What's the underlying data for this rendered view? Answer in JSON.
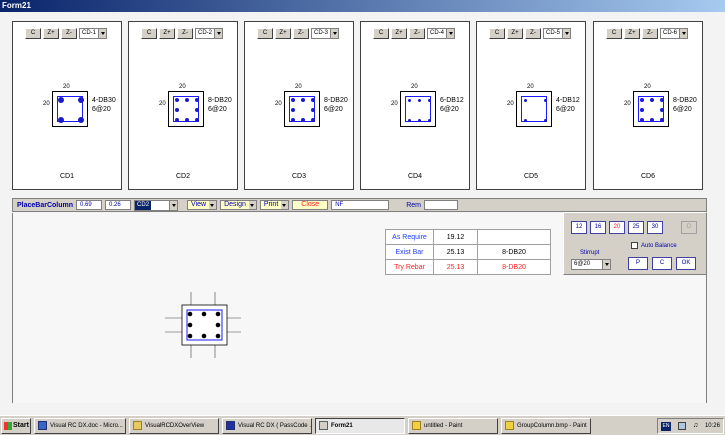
{
  "window": {
    "title": "Form21"
  },
  "panels": [
    {
      "id": "CD1",
      "combo": "CD-1",
      "dim_top": "20",
      "dim_left": "20",
      "rebar_line1": "4-DB30",
      "rebar_line2": "6@20",
      "caption": "CD1"
    },
    {
      "id": "CD2",
      "combo": "CD-2",
      "dim_top": "20",
      "dim_left": "20",
      "rebar_line1": "8-DB20",
      "rebar_line2": "6@20",
      "caption": "CD2"
    },
    {
      "id": "CD3",
      "combo": "CD-3",
      "dim_top": "20",
      "dim_left": "20",
      "rebar_line1": "8-DB20",
      "rebar_line2": "6@20",
      "caption": "CD3"
    },
    {
      "id": "CD4",
      "combo": "CD-4",
      "dim_top": "20",
      "dim_left": "20",
      "rebar_line1": "6-DB12",
      "rebar_line2": "6@20",
      "caption": "CD4"
    },
    {
      "id": "CD5",
      "combo": "CD-5",
      "dim_top": "20",
      "dim_left": "20",
      "rebar_line1": "4-DB12",
      "rebar_line2": "6@20",
      "caption": "CD5"
    },
    {
      "id": "CD6",
      "combo": "CD-6",
      "dim_top": "20",
      "dim_left": "20",
      "rebar_line1": "8-DB20",
      "rebar_line2": "6@20",
      "caption": "CD6"
    }
  ],
  "panel_buttons": {
    "c": "C",
    "zplus": "Z+",
    "zminus": "Z-"
  },
  "toolbar": {
    "label": "PlaceBarColumn",
    "field1": "0.69",
    "field2": "0.26",
    "combo": "CD2",
    "view": "View",
    "design": "Design",
    "print": "Print",
    "close": "Close",
    "nf": "NF",
    "rem": "Rem",
    "rem_value": ""
  },
  "results": {
    "rows": [
      {
        "label": "As Require",
        "value": "19.12",
        "bars": ""
      },
      {
        "label": "Exist Bar",
        "value": "25.13",
        "bars": "8-DB20"
      },
      {
        "label": "Try Rebar",
        "value": "25.13",
        "bars": "8-DB20"
      }
    ]
  },
  "right_panel": {
    "sizes": [
      "12",
      "16",
      "20",
      "25",
      "30"
    ],
    "selected_size": "20",
    "d_button": "D",
    "auto_balance": "Auto Balance",
    "stirrup_label": "Stirrupt",
    "stirrup_value": "6@20",
    "p": "P",
    "c": "C",
    "ok": "OK"
  },
  "taskbar": {
    "start": "Start",
    "items": [
      "Visual RC DX.doc - Micro...",
      "VisualRCDXOverView",
      "Visual RC DX ( PassCode ...",
      "Form21",
      "untitled - Paint",
      "GroupColumn.bmp - Paint"
    ],
    "active_index": 3,
    "lang": "EN",
    "clock": "10:26"
  },
  "colors": {
    "accent": "#0000aa",
    "rebar": "#1a1acc",
    "highlight": "#ff2020",
    "title": "#0a246a"
  }
}
